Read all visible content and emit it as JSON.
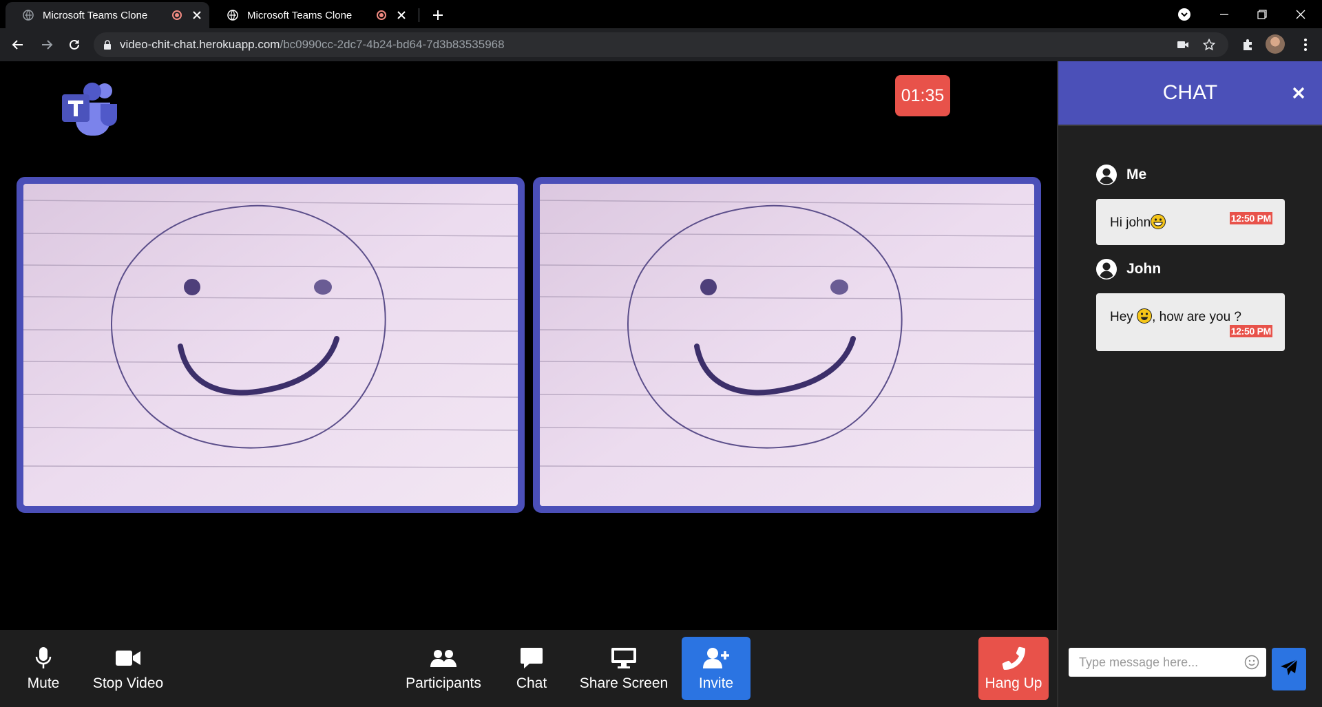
{
  "browser": {
    "tabs": [
      {
        "title": "Microsoft Teams Clone",
        "active": true
      },
      {
        "title": "Microsoft Teams Clone",
        "active": false
      }
    ],
    "url_host": "video-chit-chat.herokuapp.com",
    "url_path": "/bc0990cc-2dc7-4b24-bd64-7d3b83535968"
  },
  "meeting": {
    "timer": "01:35",
    "videos": [
      {
        "name": "local-video"
      },
      {
        "name": "remote-video"
      }
    ]
  },
  "controls": {
    "mute": "Mute",
    "stop_video": "Stop Video",
    "participants": "Participants",
    "chat": "Chat",
    "share_screen": "Share Screen",
    "invite": "Invite",
    "hang_up": "Hang Up"
  },
  "chat": {
    "title": "CHAT",
    "messages": [
      {
        "user": "Me",
        "text": "Hi john",
        "emoji": "grinning-face",
        "time": "12:50 PM"
      },
      {
        "user": "John",
        "text_before": "Hey ",
        "emoji": "smiling-face",
        "text_after": ", how are you ?",
        "time": "12:50 PM"
      }
    ],
    "input_placeholder": "Type message here..."
  },
  "colors": {
    "accent": "#4b50b8",
    "danger": "#e8524a",
    "primary": "#2b74e2"
  }
}
